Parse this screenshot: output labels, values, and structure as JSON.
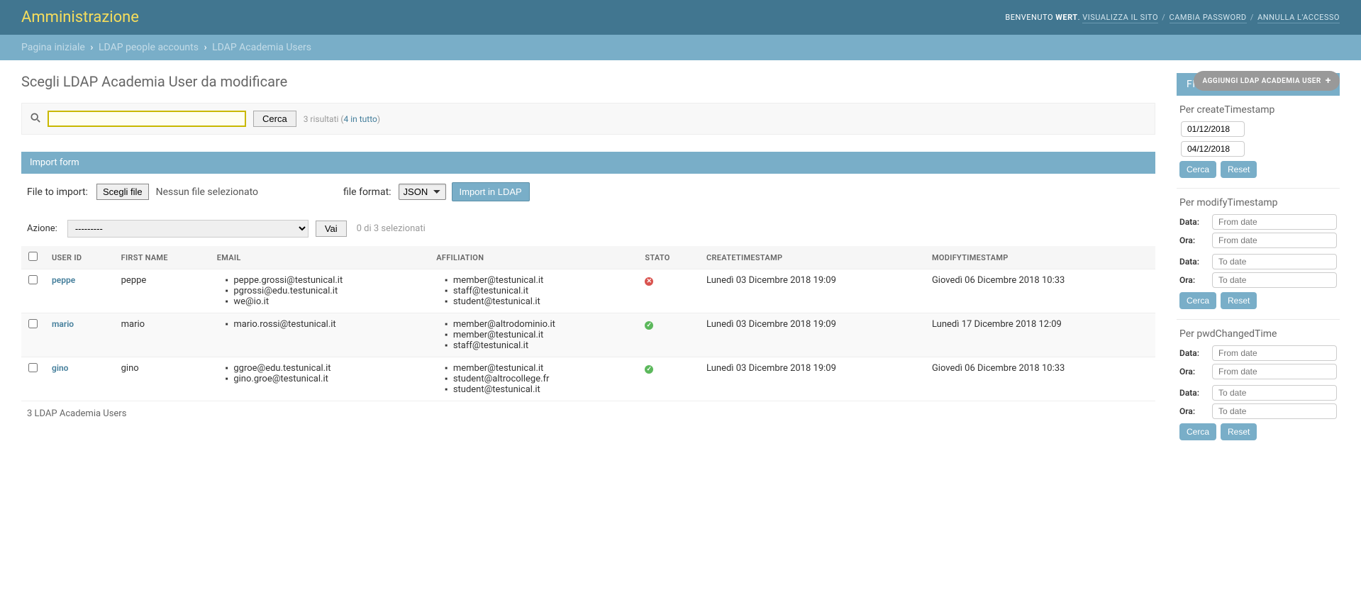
{
  "header": {
    "title": "Amministrazione",
    "welcome": "BENVENUTO",
    "username": "WERT",
    "view_site": "VISUALIZZA IL SITO",
    "change_password": "CAMBIA PASSWORD",
    "logout": "ANNULLA L'ACCESSO"
  },
  "breadcrumbs": {
    "home": "Pagina iniziale",
    "app": "LDAP people accounts",
    "current": "LDAP Academia Users"
  },
  "page_title": "Scegli LDAP Academia User da modificare",
  "object_tools": {
    "add_label": "AGGIUNGI LDAP ACADEMIA USER"
  },
  "search": {
    "button": "Cerca",
    "results_prefix": "3 risultati (",
    "results_link": "4 in tutto",
    "results_suffix": ")"
  },
  "import_form": {
    "title": "Import form",
    "file_label": "File to import:",
    "choose_file": "Scegli file",
    "no_file": "Nessun file selezionato",
    "format_label": "file format:",
    "format_value": "JSON",
    "import_button": "Import in LDAP"
  },
  "actions": {
    "label": "Azione:",
    "placeholder": "---------",
    "go": "Vai",
    "counter": "0 di 3 selezionati"
  },
  "columns": {
    "user_id": "USER ID",
    "first_name": "FIRST NAME",
    "email": "EMAIL",
    "affiliation": "AFFILIATION",
    "stato": "STATO",
    "create": "CREATETIMESTAMP",
    "modify": "MODIFYTIMESTAMP"
  },
  "rows": [
    {
      "user_id": "peppe",
      "first_name": "peppe",
      "emails": [
        "peppe.grossi@testunical.it",
        "pgrossi@edu.testunical.it",
        "we@io.it"
      ],
      "affiliations": [
        "member@testunical.it",
        "staff@testunical.it",
        "student@testunical.it"
      ],
      "status": "red",
      "create": "Lunedì 03 Dicembre 2018 19:09",
      "modify": "Giovedì 06 Dicembre 2018 10:33"
    },
    {
      "user_id": "mario",
      "first_name": "mario",
      "emails": [
        "mario.rossi@testunical.it"
      ],
      "affiliations": [
        "member@altrodominio.it",
        "member@testunical.it",
        "staff@testunical.it"
      ],
      "status": "green",
      "create": "Lunedì 03 Dicembre 2018 19:09",
      "modify": "Lunedì 17 Dicembre 2018 12:09"
    },
    {
      "user_id": "gino",
      "first_name": "gino",
      "emails": [
        "ggroe@edu.testunical.it",
        "gino.groe@testunical.it"
      ],
      "affiliations": [
        "member@testunical.it",
        "student@altrocollege.fr",
        "student@testunical.it"
      ],
      "status": "green",
      "create": "Lunedì 03 Dicembre 2018 19:09",
      "modify": "Giovedì 06 Dicembre 2018 10:33"
    }
  ],
  "paginator": "3 LDAP Academia Users",
  "filter": {
    "title": "FILTRA",
    "sections": {
      "createTimestamp": {
        "title": "Per createTimestamp",
        "from": "01/12/2018",
        "to": "04/12/2018"
      },
      "modifyTimestamp": {
        "title": "Per modifyTimestamp"
      },
      "pwdChangedTime": {
        "title": "Per pwdChangedTime"
      }
    },
    "labels": {
      "data": "Data:",
      "ora": "Ora:",
      "from_date": "From date",
      "to_date": "To date",
      "cerca": "Cerca",
      "reset": "Reset"
    }
  }
}
